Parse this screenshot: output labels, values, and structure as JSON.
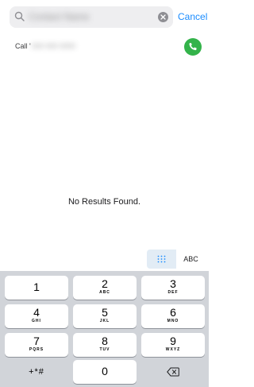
{
  "search": {
    "query_redacted": "Contact Name",
    "cancel_label": "Cancel"
  },
  "call_row": {
    "label": "Call '",
    "number_redacted": "000 000 0000"
  },
  "empty_state": {
    "message": "No Results Found."
  },
  "keyboard_toggle": {
    "abc_label": "ABC"
  },
  "keypad": {
    "keys": [
      {
        "digit": "1",
        "letters": ""
      },
      {
        "digit": "2",
        "letters": "ABC"
      },
      {
        "digit": "3",
        "letters": "DEF"
      },
      {
        "digit": "4",
        "letters": "GHI"
      },
      {
        "digit": "5",
        "letters": "JKL"
      },
      {
        "digit": "6",
        "letters": "MNO"
      },
      {
        "digit": "7",
        "letters": "PQRS"
      },
      {
        "digit": "8",
        "letters": "TUV"
      },
      {
        "digit": "9",
        "letters": "WXYZ"
      }
    ],
    "symbols_label": "+*#",
    "zero": "0"
  },
  "colors": {
    "accent_blue": "#1a8cff",
    "call_green": "#33b34a",
    "keypad_bg": "#d1d4d9"
  }
}
